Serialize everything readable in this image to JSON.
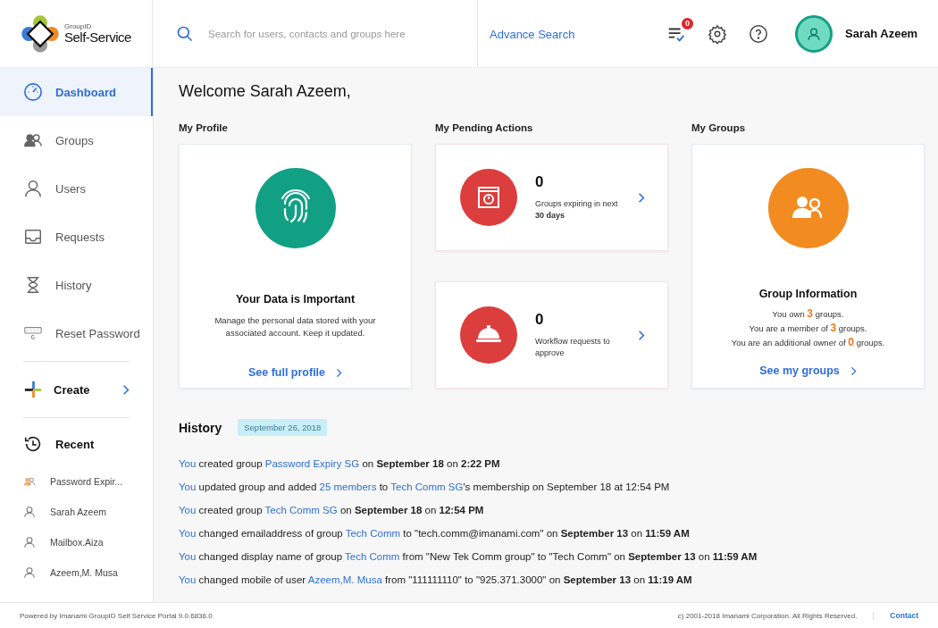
{
  "brand": {
    "small": "GroupID",
    "name": "Self-Service"
  },
  "search": {
    "placeholder": "Search for users, contacts and groups here"
  },
  "advance_search": "Advance Search",
  "header": {
    "badge": "0",
    "user": "Sarah Azeem"
  },
  "sidebar": {
    "items": [
      {
        "label": "Dashboard",
        "kind": "dashboard",
        "selected": true
      },
      {
        "label": "Groups",
        "kind": "groups",
        "selected": false
      },
      {
        "label": "Users",
        "kind": "user",
        "selected": false
      },
      {
        "label": "Requests",
        "kind": "inbox",
        "selected": false
      },
      {
        "label": "History",
        "kind": "hourglass",
        "selected": false
      },
      {
        "label": "Reset Password",
        "kind": "password",
        "selected": false
      }
    ],
    "create": "Create",
    "recent": {
      "title": "Recent",
      "items": [
        {
          "label": "Password Expir...",
          "kind": "group"
        },
        {
          "label": "Sarah Azeem",
          "kind": "user"
        },
        {
          "label": "Mailbox.Aiza",
          "kind": "user"
        },
        {
          "label": "Azeem,M. Musa",
          "kind": "user"
        }
      ]
    }
  },
  "welcome": "Welcome Sarah Azeem,",
  "profile": {
    "title": "My Profile",
    "heading": "Your Data is Important",
    "text": "Manage the personal data stored with your associated account. Keep it updated.",
    "link": "See full profile"
  },
  "pending": {
    "title": "My Pending Actions",
    "items": [
      {
        "kind": "calendar",
        "count": "0",
        "text": "Groups expiring in next **30 days**"
      },
      {
        "kind": "bell",
        "count": "0",
        "text": "Workflow requests to approve"
      }
    ]
  },
  "groups": {
    "title": "My Groups",
    "heading": "Group Information",
    "lines": [
      [
        {
          "kind": "plain",
          "text": "You own "
        },
        {
          "kind": "count",
          "text": "3"
        },
        {
          "kind": "plain",
          "text": " groups."
        }
      ],
      [
        {
          "kind": "plain",
          "text": "You are a member of "
        },
        {
          "kind": "count",
          "text": "3"
        },
        {
          "kind": "plain",
          "text": " groups."
        }
      ],
      [
        {
          "kind": "plain",
          "text": "You are an additional owner of "
        },
        {
          "kind": "count",
          "text": "0"
        },
        {
          "kind": "plain",
          "text": " groups."
        }
      ]
    ],
    "link": "See my groups"
  },
  "history": {
    "title": "History",
    "date": "September 26, 2018",
    "entries": [
      [
        {
          "kind": "link",
          "text": "You"
        },
        {
          "kind": "plain",
          "text": " created group "
        },
        {
          "kind": "link",
          "text": "Password Expiry SG"
        },
        {
          "kind": "plain",
          "text": " on "
        },
        {
          "kind": "bold",
          "text": "September 18"
        },
        {
          "kind": "plain",
          "text": " on "
        },
        {
          "kind": "bold",
          "text": "2:22 PM"
        }
      ],
      [
        {
          "kind": "link",
          "text": "You"
        },
        {
          "kind": "plain",
          "text": " updated group and added "
        },
        {
          "kind": "link",
          "text": "25 members"
        },
        {
          "kind": "plain",
          "text": " to "
        },
        {
          "kind": "link",
          "text": "Tech Comm SG"
        },
        {
          "kind": "plain",
          "text": "'s membership on September 18 at 12:54 PM"
        }
      ],
      [
        {
          "kind": "link",
          "text": "You"
        },
        {
          "kind": "plain",
          "text": " created group "
        },
        {
          "kind": "link",
          "text": "Tech Comm SG"
        },
        {
          "kind": "plain",
          "text": " on "
        },
        {
          "kind": "bold",
          "text": "September 18"
        },
        {
          "kind": "plain",
          "text": " on "
        },
        {
          "kind": "bold",
          "text": "12:54 PM"
        }
      ],
      [
        {
          "kind": "link",
          "text": "You"
        },
        {
          "kind": "plain",
          "text": " changed emailaddress of group "
        },
        {
          "kind": "link",
          "text": "Tech Comm"
        },
        {
          "kind": "plain",
          "text": " to \"tech.comm@imanami.com\" on "
        },
        {
          "kind": "bold",
          "text": "September 13"
        },
        {
          "kind": "plain",
          "text": " on "
        },
        {
          "kind": "bold",
          "text": "11:59 AM"
        }
      ],
      [
        {
          "kind": "link",
          "text": "You"
        },
        {
          "kind": "plain",
          "text": " changed display name of group "
        },
        {
          "kind": "link",
          "text": "Tech Comm"
        },
        {
          "kind": "plain",
          "text": " from \"New Tek Comm group\" to \"Tech Comm\" on "
        },
        {
          "kind": "bold",
          "text": "September 13"
        },
        {
          "kind": "plain",
          "text": " on "
        },
        {
          "kind": "bold",
          "text": "11:59 AM"
        }
      ],
      [
        {
          "kind": "link",
          "text": "You"
        },
        {
          "kind": "plain",
          "text": " changed mobile of user "
        },
        {
          "kind": "link",
          "text": "Azeem,M. Musa"
        },
        {
          "kind": "plain",
          "text": " from \"111111110\" to \"925.371.3000\" on "
        },
        {
          "kind": "bold",
          "text": "September 13"
        },
        {
          "kind": "plain",
          "text": " on "
        },
        {
          "kind": "bold",
          "text": "11:19 AM"
        }
      ]
    ]
  },
  "footer": {
    "powered": "Powered by Imanami GroupID Self Service Portal 9.0.6836.0",
    "copyright": "c) 2001-2018 Imanami Corporation. All Rights Reserved.",
    "contact": "Contact"
  }
}
